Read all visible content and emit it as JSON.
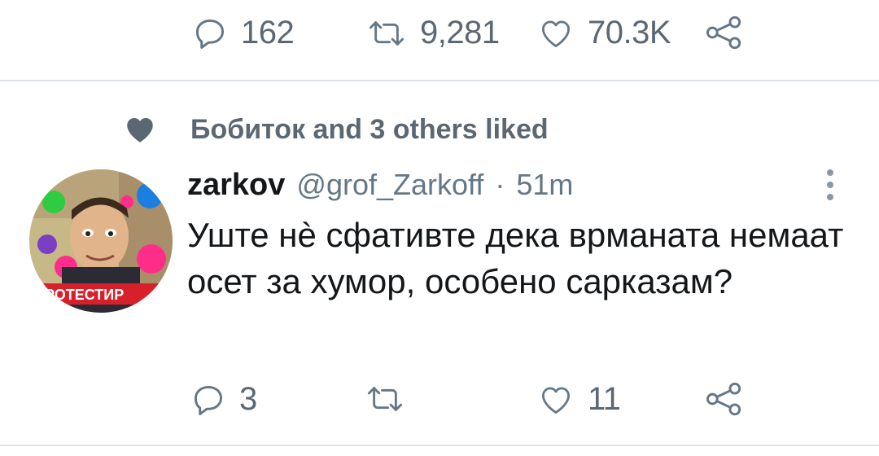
{
  "top_actions": {
    "reply_count": "162",
    "retweet_count": "9,281",
    "like_count": "70.3K",
    "icons": [
      "reply-icon",
      "retweet-icon",
      "like-icon",
      "share-icon"
    ]
  },
  "social_context": {
    "icon": "heart-icon",
    "text": "Бобиток and 3 others liked"
  },
  "tweet": {
    "name": "zarkov",
    "handle": "@grof_Zarkoff",
    "separator": "·",
    "time": "51m",
    "text": "Уште нè сфативте дека врманата немаат осет за хумор, особено сарказам?",
    "avatar_caption": "ПРОТЕСТИР",
    "reply_count": "3",
    "like_count": "11",
    "more_icon": "more-vertical-icon"
  },
  "colors": {
    "text_primary": "#14171a",
    "text_secondary": "#657786",
    "divider": "#dde2e6",
    "heart": "#5b6772"
  }
}
